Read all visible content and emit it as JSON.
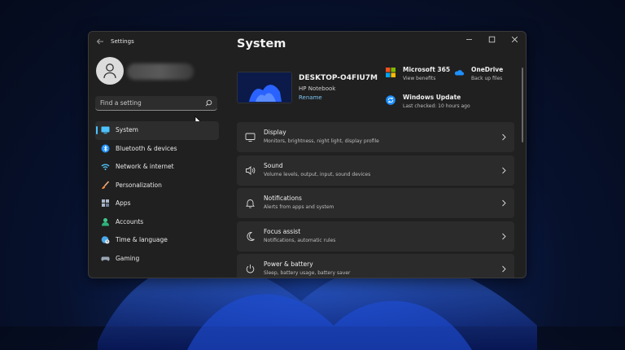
{
  "window": {
    "app_title": "Settings"
  },
  "search": {
    "placeholder": "Find a setting"
  },
  "sidebar": {
    "items": [
      {
        "label": "System",
        "icon": "system-icon",
        "active": true
      },
      {
        "label": "Bluetooth & devices",
        "icon": "bluetooth-icon"
      },
      {
        "label": "Network & internet",
        "icon": "network-icon"
      },
      {
        "label": "Personalization",
        "icon": "brush-icon"
      },
      {
        "label": "Apps",
        "icon": "apps-icon"
      },
      {
        "label": "Accounts",
        "icon": "account-icon"
      },
      {
        "label": "Time & language",
        "icon": "globe-clock-icon"
      },
      {
        "label": "Gaming",
        "icon": "gamepad-icon"
      }
    ]
  },
  "main": {
    "title": "System",
    "device": {
      "name": "DESKTOP-O4FIU7M",
      "model": "HP Notebook",
      "rename_label": "Rename"
    },
    "quick": [
      {
        "title": "Microsoft 365",
        "subtitle": "View benefits",
        "icon": "microsoft-logo-icon"
      },
      {
        "title": "OneDrive",
        "subtitle": "Back up files",
        "icon": "onedrive-icon"
      },
      {
        "title": "Windows Update",
        "subtitle": "Last checked: 10 hours ago",
        "icon": "update-icon"
      }
    ],
    "cards": [
      {
        "title": "Display",
        "subtitle": "Monitors, brightness, night light, display profile",
        "icon": "display-icon"
      },
      {
        "title": "Sound",
        "subtitle": "Volume levels, output, input, sound devices",
        "icon": "speaker-icon"
      },
      {
        "title": "Notifications",
        "subtitle": "Alerts from apps and system",
        "icon": "bell-icon"
      },
      {
        "title": "Focus assist",
        "subtitle": "Notifications, automatic rules",
        "icon": "moon-icon"
      },
      {
        "title": "Power & battery",
        "subtitle": "Sleep, battery usage, battery saver",
        "icon": "power-icon"
      }
    ]
  },
  "colors": {
    "accent": "#4cc2ff",
    "window_bg": "#202020",
    "card_bg": "#2b2b2b"
  }
}
